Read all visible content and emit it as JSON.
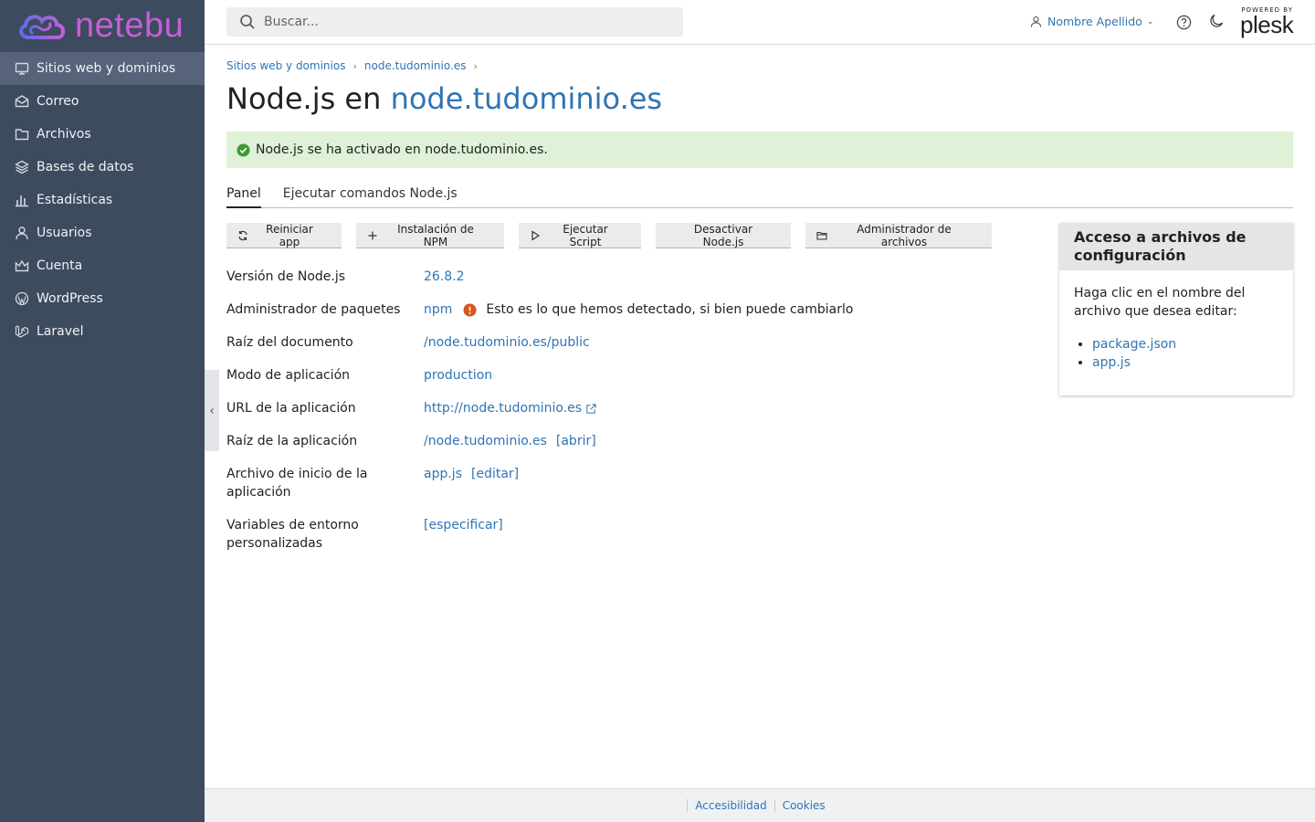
{
  "brand": {
    "name": "netebu"
  },
  "sidebar": {
    "items": [
      {
        "label": "Sitios web y dominios",
        "icon": "monitor-icon",
        "active": true
      },
      {
        "label": "Correo",
        "icon": "mail-icon"
      },
      {
        "label": "Archivos",
        "icon": "folder-icon"
      },
      {
        "label": "Bases de datos",
        "icon": "database-icon"
      },
      {
        "label": "Estadísticas",
        "icon": "bar-chart-icon"
      },
      {
        "label": "Usuarios",
        "icon": "user-icon"
      },
      {
        "label": "Cuenta",
        "icon": "crown-icon"
      },
      {
        "label": "WordPress",
        "icon": "wordpress-icon"
      },
      {
        "label": "Laravel",
        "icon": "laravel-icon"
      }
    ]
  },
  "header": {
    "search_placeholder": "Buscar...",
    "user_name": "Nombre Apellido",
    "powered_by": "POWERED BY",
    "plesk": "plesk"
  },
  "breadcrumb": [
    "Sitios web y dominios",
    "node.tudominio.es"
  ],
  "page": {
    "title_prefix": "Node.js en",
    "title_domain": "node.tudominio.es"
  },
  "alert": {
    "message": "Node.js se ha activado en node.tudominio.es."
  },
  "tabs": [
    {
      "label": "Panel",
      "active": true
    },
    {
      "label": "Ejecutar comandos Node.js",
      "active": false
    }
  ],
  "toolbar": {
    "restart": "Reiniciar app",
    "npm_install": "Instalación de NPM",
    "run_script": "Ejecutar Script",
    "disable": "Desactivar Node.js",
    "file_manager": "Administrador de archivos"
  },
  "props": {
    "version_label": "Versión de Node.js",
    "version_value": "26.8.2",
    "pkg_label": "Administrador de paquetes",
    "pkg_value": "npm",
    "pkg_note": "Esto es lo que hemos detectado, si bien puede cambiarlo",
    "docroot_label": "Raíz del documento",
    "docroot_value": "/node.tudominio.es/public",
    "mode_label": "Modo de aplicación",
    "mode_value": "production",
    "url_label": "URL de la aplicación",
    "url_value": "http://node.tudominio.es",
    "approot_label": "Raíz de la aplicación",
    "approot_value": "/node.tudominio.es",
    "approot_action": "[abrir]",
    "startup_label": "Archivo de inicio de la aplicación",
    "startup_value": "app.js",
    "startup_action": "[editar]",
    "env_label": "Variables de entorno personalizadas",
    "env_action": "[especificar]"
  },
  "config_panel": {
    "title": "Acceso a archivos de configuración",
    "intro": "Haga clic en el nombre del archivo que desea editar:",
    "files": [
      "package.json",
      "app.js"
    ]
  },
  "footer": {
    "accessibility": "Accesibilidad",
    "cookies": "Cookies"
  },
  "colors": {
    "sidebar": "#3d4b5f",
    "link": "#2f74b5",
    "alert_bg": "#dff2d8",
    "warn": "#d9531e",
    "ok": "#3d9b35"
  }
}
